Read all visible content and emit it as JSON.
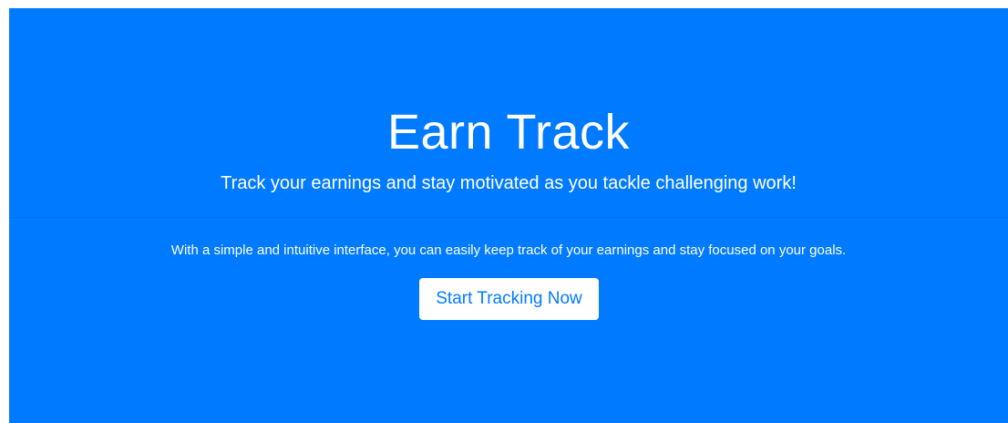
{
  "hero": {
    "title": "Earn Track",
    "subtitle": "Track your earnings and stay motivated as you tackle challenging work!",
    "description": "With a simple and intuitive interface, you can easily keep track of your earnings and stay focused on your goals.",
    "cta_label": "Start Tracking Now"
  },
  "colors": {
    "background": "#007bff",
    "text": "#ffffff",
    "button_background": "#ffffff",
    "button_text": "#007bff"
  }
}
